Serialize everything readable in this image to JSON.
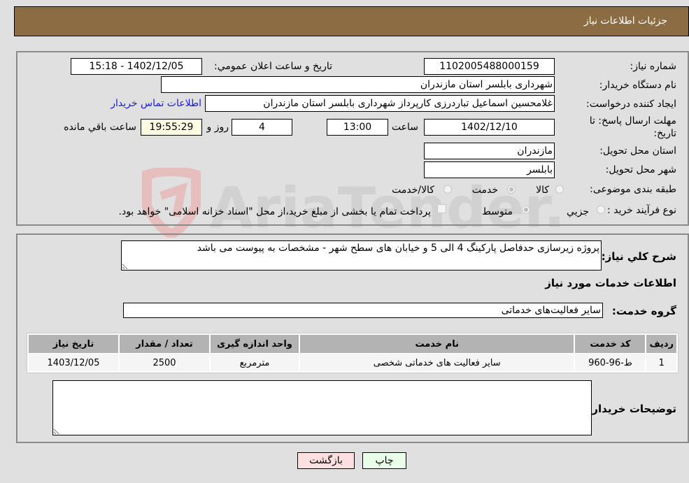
{
  "header": {
    "title": "جزئیات اطلاعات نیاز"
  },
  "form": {
    "need_number": {
      "label": "شماره نیاز:",
      "value": "1102005488000159"
    },
    "announce_datetime": {
      "label": "تاریخ و ساعت اعلان عمومي:",
      "value": "1402/12/05 - 15:18"
    },
    "buyer_org": {
      "label": "نام دستگاه خريدار:",
      "value": "شهرداری بابلسر استان مازندران"
    },
    "requester": {
      "label": "ايجاد کننده درخواست:",
      "value": "غلامحسین اسماعیل تباردرزی کارپرداز شهرداری بابلسر استان مازندران"
    },
    "buyer_contact_link": "اطلاعات تماس خريدار",
    "deadline": {
      "label_line1": "مهلت ارسال پاسخ: تا",
      "label_line2": "تاريخ:",
      "date": "1402/12/10",
      "time_label": "ساعت",
      "time": "13:00",
      "days": "4",
      "days_label": "روز و",
      "remaining": "19:55:29",
      "remaining_label": "ساعت باقي مانده"
    },
    "province": {
      "label": "استان محل تحويل:",
      "value": "مازندران"
    },
    "city": {
      "label": "شهر محل تحويل:",
      "value": "بابلسر"
    },
    "category": {
      "label": "طبقه بندی موضوعی:",
      "options": [
        "کالا",
        "خدمت",
        "کالا/خدمت"
      ],
      "selected": "خدمت"
    },
    "purchase_type": {
      "label": "نوع فرآيند خريد :",
      "options": [
        "جزيي",
        "متوسط"
      ],
      "selected": "متوسط",
      "treasury_note": "پرداخت تمام يا بخشی از مبلغ خريد،از محل \"اسناد خزانه اسلامی\" خواهد بود.",
      "treasury_checked": false
    }
  },
  "details": {
    "description_label": "شرح کلي نياز:",
    "description": "پروژه زیرسازی حدفاصل پارکینگ 4 الی 5 و خیابان های سطح شهر - مشخصات به پیوست می باشد",
    "services_heading": "اطلاعات خدمات مورد نياز",
    "service_group_label": "گروه خدمت:",
    "service_group": "سایر فعالیت‌های خدماتی",
    "table": {
      "columns": [
        "رديف",
        "کد خدمت",
        "نام خدمت",
        "واحد اندازه گيری",
        "تعداد / مقدار",
        "تاريخ نياز"
      ],
      "rows": [
        [
          "1",
          "ط-96-960",
          "سایر فعالیت های خدماتی شخصی",
          "مترمربع",
          "2500",
          "1403/12/05"
        ]
      ]
    },
    "buyer_notes_label": "توضيحات خريدار:",
    "buyer_notes": ""
  },
  "buttons": {
    "print": "چاپ",
    "back": "بازگشت"
  },
  "colors": {
    "header_bg": "#8c6d43",
    "print_bg": "#eaffea",
    "back_bg": "#ffe0e0",
    "link": "#1a1adb"
  }
}
